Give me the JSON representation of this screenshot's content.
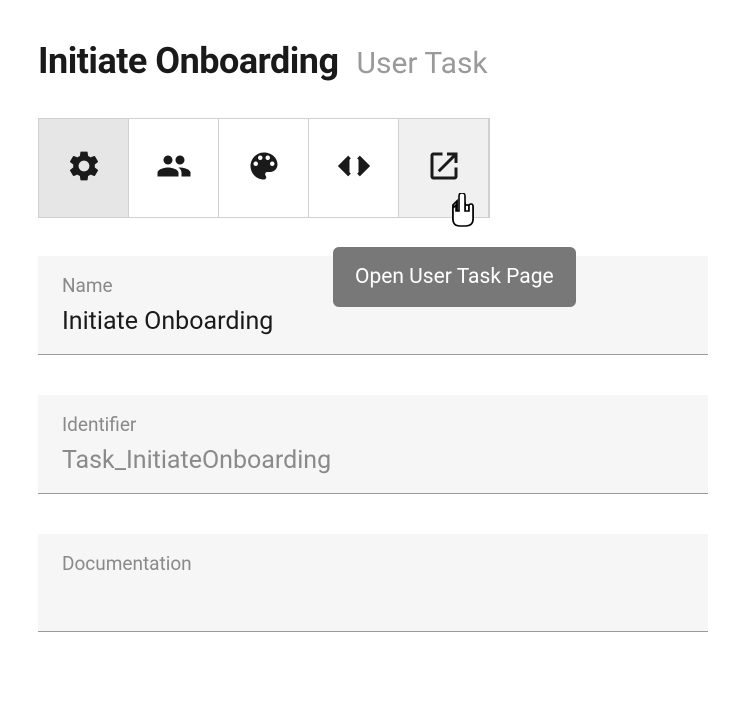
{
  "header": {
    "title": "Initiate Onboarding",
    "subtitle": "User Task"
  },
  "tabs": {
    "settings": "settings",
    "assignees": "assignees",
    "palette": "palette",
    "code": "code",
    "open": "open"
  },
  "tooltip": "Open User Task Page",
  "fields": {
    "name": {
      "label": "Name",
      "value": "Initiate Onboarding"
    },
    "identifier": {
      "label": "Identifier",
      "value": "Task_InitiateOnboarding"
    },
    "documentation": {
      "label": "Documentation",
      "value": ""
    }
  }
}
